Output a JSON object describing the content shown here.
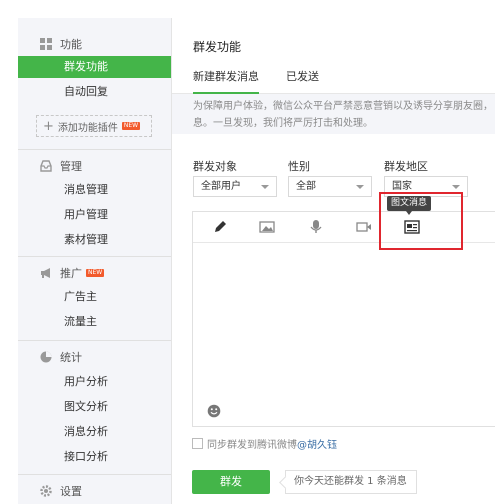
{
  "sidebar": {
    "features": {
      "heading": "功能",
      "items": [
        "群发功能",
        "自动回复"
      ],
      "add_plugin": "添加功能插件",
      "add_badge": "NEW"
    },
    "manage": {
      "heading": "管理",
      "items": [
        "消息管理",
        "用户管理",
        "素材管理"
      ]
    },
    "promote": {
      "heading": "推广",
      "badge": "NEW",
      "items": [
        "广告主",
        "流量主"
      ]
    },
    "stats": {
      "heading": "统计",
      "items": [
        "用户分析",
        "图文分析",
        "消息分析",
        "接口分析"
      ]
    },
    "settings": {
      "heading": "设置"
    }
  },
  "main": {
    "title": "群发功能",
    "tabs": [
      "新建群发消息",
      "已发送"
    ],
    "notice_line1": "为保障用户体验，微信公众平台严禁恶意营销以及诱导分享朋友圈，",
    "notice_line2": "息。一旦发现，我们将严厉打击和处理。",
    "filters": {
      "target": {
        "label": "群发对象",
        "value": "全部用户"
      },
      "gender": {
        "label": "性别",
        "value": "全部"
      },
      "region": {
        "label": "群发地区",
        "value": "国家"
      }
    },
    "tooltip": "图文消息",
    "sync_prefix": "同步群发到腾讯微博",
    "sync_user": "@胡久钰",
    "send_button": "群发",
    "remaining": "你今天还能群发 1 条消息"
  },
  "colors": {
    "accent": "#44b549",
    "highlight_box": "#e0262e"
  }
}
